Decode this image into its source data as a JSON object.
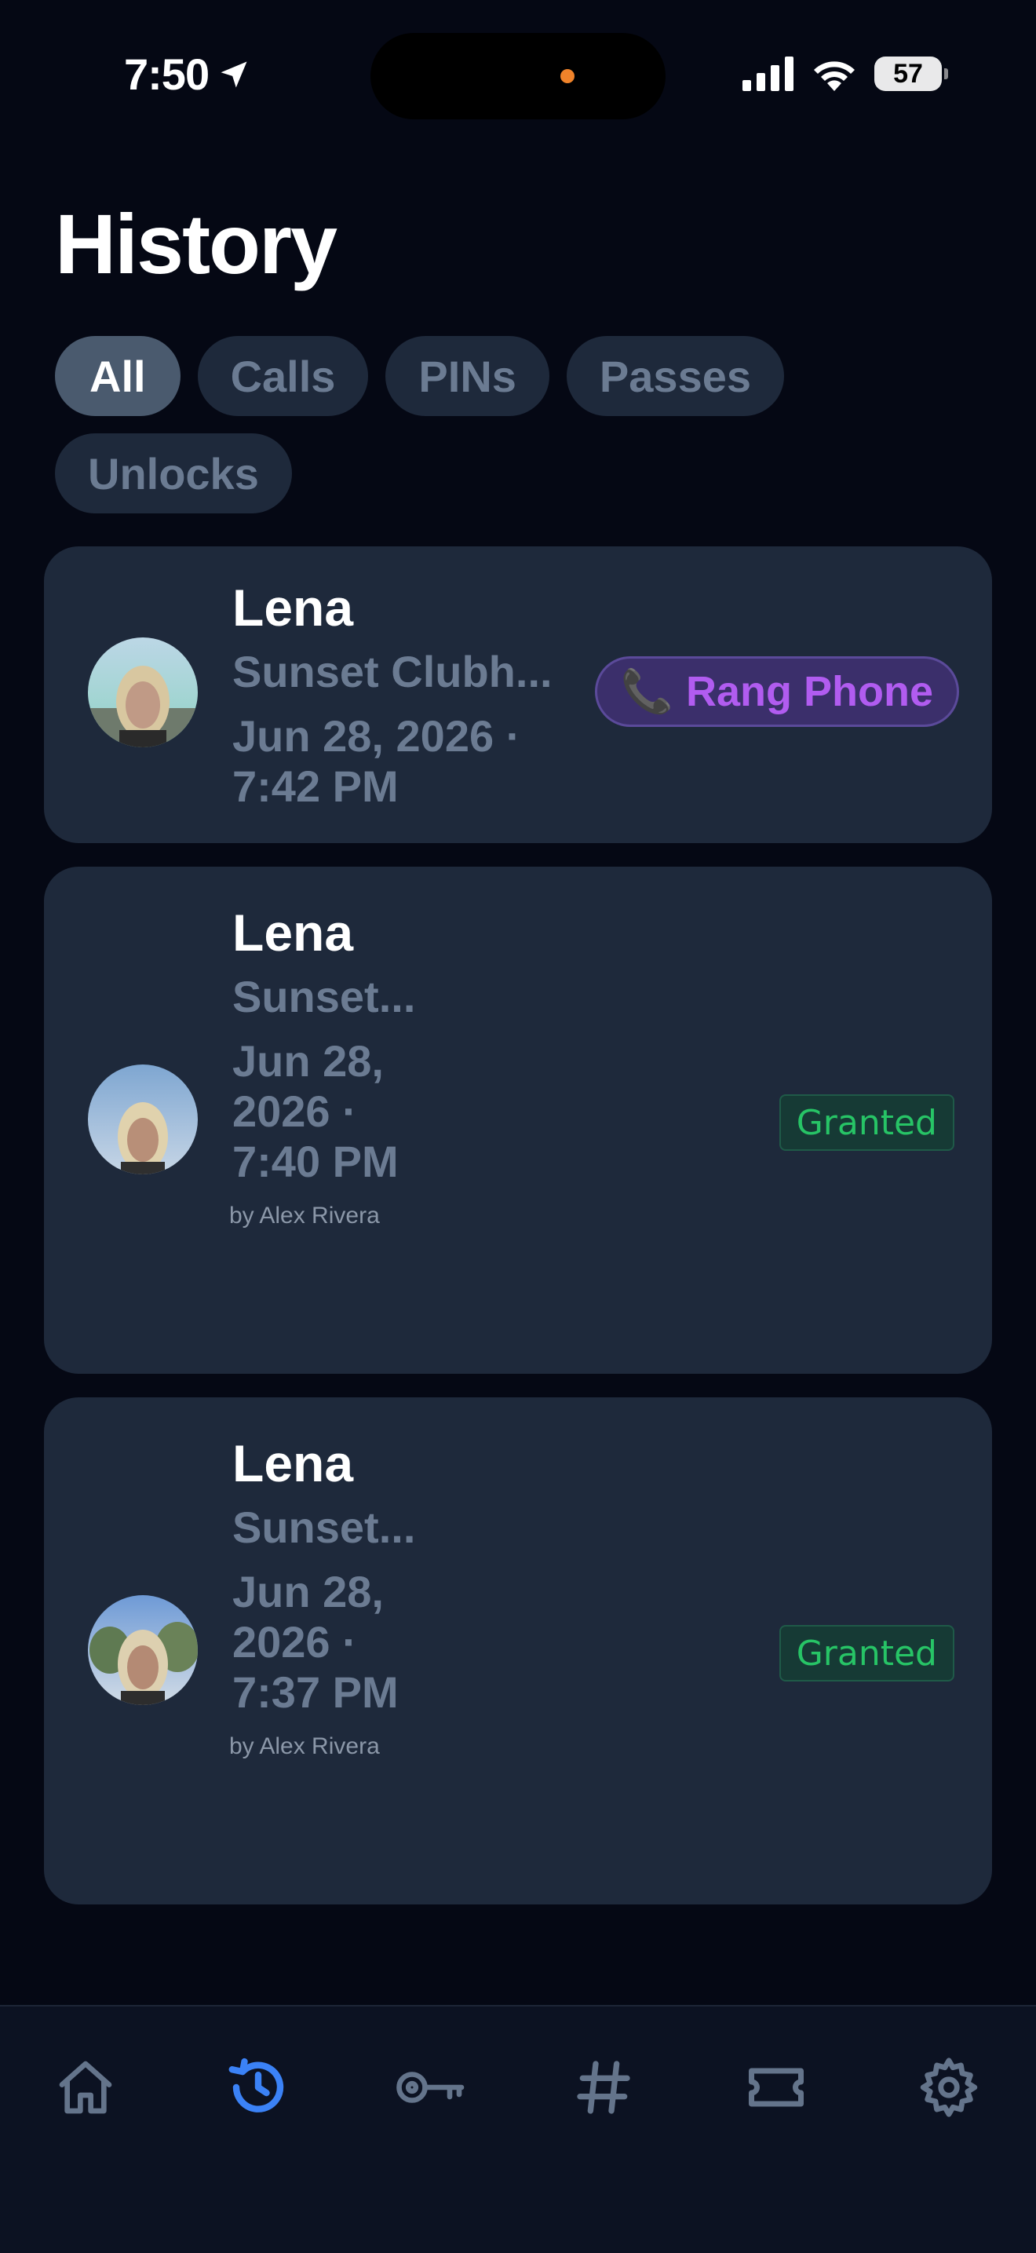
{
  "status_bar": {
    "time": "7:50",
    "battery": "57"
  },
  "header": {
    "title": "History"
  },
  "filters": [
    {
      "label": "All",
      "active": true
    },
    {
      "label": "Calls",
      "active": false
    },
    {
      "label": "PINs",
      "active": false
    },
    {
      "label": "Passes",
      "active": false
    },
    {
      "label": "Unlocks",
      "active": false
    }
  ],
  "history": [
    {
      "name": "Lena",
      "location": "Sunset Clubh...",
      "datetime_line1": "Jun 28, 2026 ·",
      "datetime_line2": "7:42 PM",
      "badge": "Rang Phone",
      "badge_icon": "phone-icon"
    },
    {
      "name": "Lena",
      "location": "Sunset...",
      "datetime_line1": "Jun 28,",
      "datetime_line2": "2026 ·",
      "datetime_line3": "7:40 PM",
      "by": "by Alex Rivera",
      "badge": "Granted"
    },
    {
      "name": "Lena",
      "location": "Sunset...",
      "datetime_line1": "Jun 28,",
      "datetime_line2": "2026 ·",
      "datetime_line3": "7:37 PM",
      "by": "by Alex Rivera",
      "badge": "Granted"
    }
  ],
  "tabbar": {
    "tabs": [
      {
        "icon": "home-icon",
        "active": false
      },
      {
        "icon": "history-icon",
        "active": true
      },
      {
        "icon": "key-icon",
        "active": false
      },
      {
        "icon": "hashtag-icon",
        "active": false
      },
      {
        "icon": "ticket-icon",
        "active": false
      },
      {
        "icon": "gear-icon",
        "active": false
      }
    ]
  },
  "colors": {
    "background": "#050814",
    "card": "#1e293b",
    "accent": "#3b82f6",
    "granted": "#27c466",
    "rang_phone": "#b15cf0"
  }
}
